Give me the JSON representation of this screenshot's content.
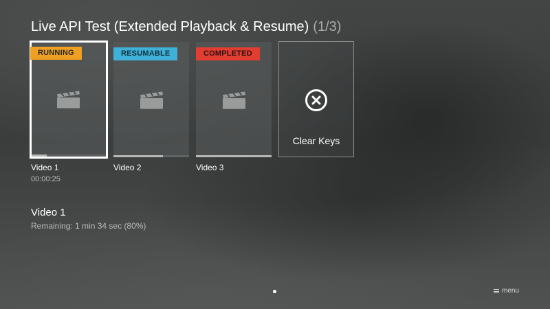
{
  "header": {
    "title": "Live API Test (Extended Playback & Resume)",
    "counter": "(1/3)"
  },
  "tiles": [
    {
      "badge": "RUNNING",
      "badge_color": "#ef9f22",
      "title": "Video 1",
      "time": "00:00:25",
      "progress": 0.2,
      "icon": "clapperboard-icon",
      "selected": true
    },
    {
      "badge": "RESUMABLE",
      "badge_color": "#3fb0d8",
      "title": "Video 2",
      "progress": 0.65,
      "icon": "clapperboard-icon"
    },
    {
      "badge": "COMPLETED",
      "badge_color": "#e23d31",
      "title": "Video 3",
      "progress": 1.0,
      "icon": "clapperboard-icon"
    }
  ],
  "clear_keys": {
    "label": "Clear Keys",
    "icon": "close-circle-icon"
  },
  "detail": {
    "title": "Video 1",
    "subtitle": "Remaining: 1 min 34 sec (80%)"
  },
  "footer": {
    "menu_label": "menu",
    "menu_icon": "menu-lines-icon"
  }
}
